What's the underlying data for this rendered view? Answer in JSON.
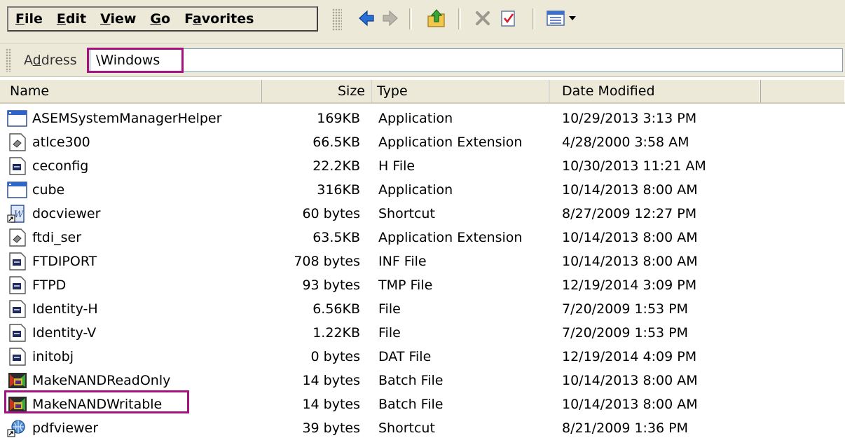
{
  "menu": [
    {
      "acc": "F",
      "rest": "ile"
    },
    {
      "acc": "E",
      "rest": "dit"
    },
    {
      "acc": "V",
      "rest": "iew"
    },
    {
      "acc": "G",
      "rest": "o"
    },
    {
      "pre": "F",
      "acc": "a",
      "rest": "vorites"
    }
  ],
  "toolbar_icons": [
    "back-arrow-icon",
    "forward-arrow-icon",
    "up-folder-icon",
    "delete-icon",
    "properties-icon",
    "views-icon"
  ],
  "address": {
    "label_pre": "A",
    "label_acc": "d",
    "label_rest": "dress",
    "value": "\\Windows"
  },
  "columns": {
    "name": "Name",
    "size": "Size",
    "type": "Type",
    "date": "Date Modified"
  },
  "files": [
    {
      "name": "ASEMSystemManagerHelper",
      "size": "169KB",
      "type": "Application",
      "date": "10/29/2013 3:13 PM",
      "icon": "application-icon"
    },
    {
      "name": "atlce300",
      "size": "66.5KB",
      "type": "Application Extension",
      "date": "4/28/2000 3:58 AM",
      "icon": "dll-icon"
    },
    {
      "name": "ceconfig",
      "size": "22.2KB",
      "type": "H File",
      "date": "10/30/2013 11:21 AM",
      "icon": "document-icon"
    },
    {
      "name": "cube",
      "size": "316KB",
      "type": "Application",
      "date": "10/14/2013 8:00 AM",
      "icon": "application-icon"
    },
    {
      "name": "docviewer",
      "size": "60 bytes",
      "type": "Shortcut",
      "date": "8/27/2009 12:27 PM",
      "icon": "word-shortcut-icon"
    },
    {
      "name": "ftdi_ser",
      "size": "63.5KB",
      "type": "Application Extension",
      "date": "10/14/2013 8:00 AM",
      "icon": "dll-icon"
    },
    {
      "name": "FTDIPORT",
      "size": "708 bytes",
      "type": "INF File",
      "date": "10/14/2013 8:00 AM",
      "icon": "document-icon"
    },
    {
      "name": "FTPD",
      "size": "93 bytes",
      "type": "TMP File",
      "date": "12/19/2014 3:09 PM",
      "icon": "document-icon"
    },
    {
      "name": "Identity-H",
      "size": "6.56KB",
      "type": "File",
      "date": "7/20/2009 1:53 PM",
      "icon": "document-icon"
    },
    {
      "name": "Identity-V",
      "size": "1.22KB",
      "type": "File",
      "date": "7/20/2009 1:53 PM",
      "icon": "document-icon"
    },
    {
      "name": "initobj",
      "size": "0 bytes",
      "type": "DAT File",
      "date": "12/19/2014 4:09 PM",
      "icon": "document-icon"
    },
    {
      "name": "MakeNANDReadOnly",
      "size": "14 bytes",
      "type": "Batch File",
      "date": "10/14/2013 8:00 AM",
      "icon": "batch-file-icon"
    },
    {
      "name": "MakeNANDWritable",
      "size": "14 bytes",
      "type": "Batch File",
      "date": "10/14/2013 8:00 AM",
      "icon": "batch-file-icon"
    },
    {
      "name": "pdfviewer",
      "size": "39 bytes",
      "type": "Shortcut",
      "date": "8/21/2009 1:36 PM",
      "icon": "pdf-shortcut-icon"
    }
  ],
  "highlight_color": "#a3127f"
}
